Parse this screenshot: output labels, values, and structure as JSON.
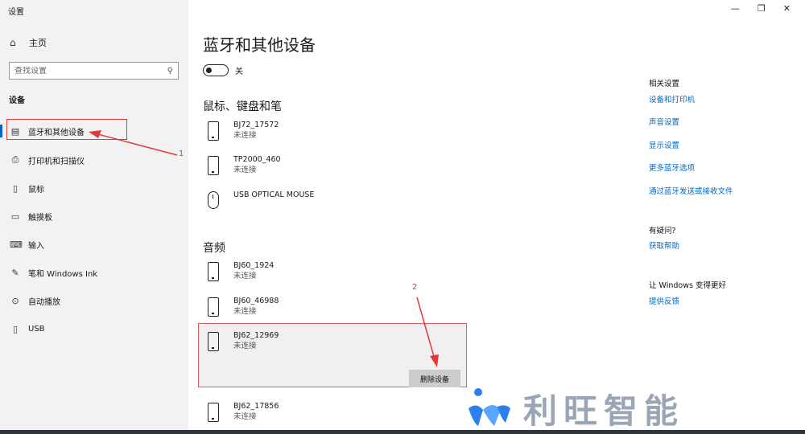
{
  "app_title": "设置",
  "window_controls": {
    "minimize": "—",
    "restore": "❐",
    "close": "✕"
  },
  "sidebar": {
    "home_label": "主页",
    "search_placeholder": "查找设置",
    "section_label": "设备",
    "items": [
      {
        "label": "蓝牙和其他设备",
        "icon": "bluetooth-devices-icon",
        "active": true
      },
      {
        "label": "打印机和扫描仪",
        "icon": "printer-icon"
      },
      {
        "label": "鼠标",
        "icon": "mouse-icon"
      },
      {
        "label": "触摸板",
        "icon": "touchpad-icon"
      },
      {
        "label": "输入",
        "icon": "keyboard-icon"
      },
      {
        "label": "笔和 Windows Ink",
        "icon": "pen-icon"
      },
      {
        "label": "自动播放",
        "icon": "autoplay-icon"
      },
      {
        "label": "USB",
        "icon": "usb-icon"
      }
    ]
  },
  "main": {
    "title": "蓝牙和其他设备",
    "bluetooth_toggle_label": "关",
    "groups": [
      {
        "title": "鼠标、键盘和笔",
        "devices": [
          {
            "name": "BJ72_17572",
            "status": "未连接",
            "icon": "phone-icon"
          },
          {
            "name": "TP2000_460",
            "status": "未连接",
            "icon": "phone-icon"
          },
          {
            "name": "USB OPTICAL MOUSE",
            "status": "",
            "icon": "mouse-icon"
          }
        ]
      },
      {
        "title": "音频",
        "devices": [
          {
            "name": "BJ60_1924",
            "status": "未连接",
            "icon": "phone-icon"
          },
          {
            "name": "BJ60_46988",
            "status": "未连接",
            "icon": "phone-icon"
          },
          {
            "name": "BJ62_12969",
            "status": "未连接",
            "icon": "phone-icon",
            "selected": true
          },
          {
            "name": "BJ62_17856",
            "status": "未连接",
            "icon": "phone-icon"
          }
        ]
      }
    ],
    "remove_button_label": "删除设备"
  },
  "annotations": {
    "step1": "1",
    "step2": "2",
    "color": "#e03a3a"
  },
  "right": {
    "related_heading": "相关设置",
    "related_links": [
      "设备和打印机",
      "声音设置",
      "显示设置",
      "更多蓝牙选项",
      "通过蓝牙发送或接收文件"
    ],
    "help_heading": "有疑问?",
    "help_link": "获取帮助",
    "feedback_heading": "让 Windows 变得更好",
    "feedback_link": "提供反馈"
  },
  "watermark": {
    "text": "利旺智能"
  },
  "colors": {
    "accent": "#0067c0",
    "sidebar_bg": "#f2f2f2"
  }
}
